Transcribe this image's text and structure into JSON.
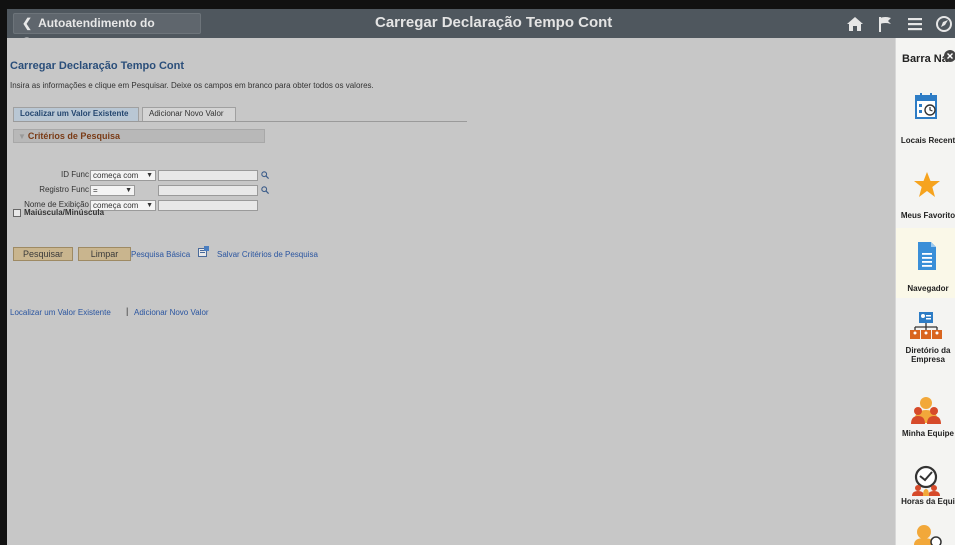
{
  "header": {
    "back_label": "Autoatendimento do Gerente",
    "title": "Carregar Declaração Tempo Cont",
    "icons": [
      "home-icon",
      "flag-icon",
      "menu-icon",
      "navbar-icon"
    ]
  },
  "page": {
    "title": "Carregar Declaração Tempo Cont",
    "instructions": "Insira as informações e clique em Pesquisar. Deixe os campos em branco para obter todos os valores.",
    "tabs": [
      "Localizar um Valor Existente",
      "Adicionar Novo Valor"
    ],
    "section_title": "Critérios de Pesquisa",
    "fields": [
      {
        "label": "ID Func",
        "operator": "começa com",
        "value": ""
      },
      {
        "label": "Registro Func",
        "operator": "=",
        "value": ""
      },
      {
        "label": "Nome de Exibição",
        "operator": "começa com",
        "value": ""
      }
    ],
    "case_checkbox_label": "Maiúscula/Minúscula",
    "buttons": {
      "search": "Pesquisar",
      "clear": "Limpar"
    },
    "links": {
      "basic_search": "Pesquisa Básica",
      "save_criteria": "Salvar Critérios de Pesquisa"
    },
    "bottom_links": {
      "find": "Localizar um Valor Existente",
      "separator": "|",
      "add": "Adicionar Novo Valor"
    }
  },
  "navbar": {
    "title": "Barra Na",
    "items": [
      {
        "label": "Locais Recent",
        "icon": "calendar-clock-icon"
      },
      {
        "label": "Meus Favorito",
        "icon": "star-icon"
      },
      {
        "label": "Navegador",
        "icon": "document-icon"
      },
      {
        "label": "Diretório da Empresa",
        "icon": "org-chart-icon"
      },
      {
        "label": "Minha Equipe",
        "icon": "team-icon"
      },
      {
        "label": "Horas da Equi",
        "icon": "team-time-icon"
      }
    ]
  },
  "colors": {
    "header_bg": "#4f575e",
    "main_bg": "#c7c7c7",
    "title_blue": "#2a4e7a",
    "section_text": "#7a3b16",
    "button_bg": "#c9b58e",
    "star": "#f6a31e",
    "nav_blue": "#3a8fd8"
  }
}
